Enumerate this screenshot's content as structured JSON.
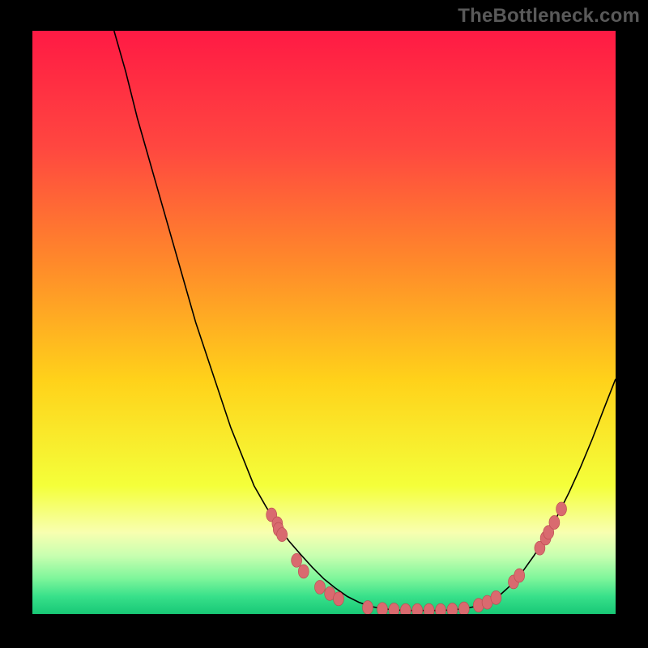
{
  "watermark": "TheBottleneck.com",
  "colors": {
    "bg": "#000000",
    "watermark": "#595959",
    "curve_stroke": "#000000",
    "marker_fill": "#d96a6f",
    "marker_stroke": "#b94a4f",
    "gradient_stops": [
      {
        "offset": 0.0,
        "color": "#ff1a44"
      },
      {
        "offset": 0.2,
        "color": "#ff4740"
      },
      {
        "offset": 0.4,
        "color": "#ff8a2a"
      },
      {
        "offset": 0.6,
        "color": "#ffd21a"
      },
      {
        "offset": 0.78,
        "color": "#f4ff3a"
      },
      {
        "offset": 0.86,
        "color": "#f8ffb0"
      },
      {
        "offset": 0.9,
        "color": "#c8ffb0"
      },
      {
        "offset": 0.94,
        "color": "#7cf59a"
      },
      {
        "offset": 0.97,
        "color": "#38e08a"
      },
      {
        "offset": 1.0,
        "color": "#18c876"
      }
    ]
  },
  "chart_data": {
    "type": "line",
    "title": "",
    "xlabel": "",
    "ylabel": "",
    "xlim": [
      0,
      100
    ],
    "ylim": [
      0,
      100
    ],
    "x": [
      0,
      2,
      4,
      6,
      8,
      10,
      12,
      14,
      16,
      18,
      20,
      22,
      24,
      26,
      28,
      30,
      32,
      34,
      36,
      38,
      40,
      42,
      44,
      46,
      48,
      50,
      52,
      54,
      56,
      58,
      60,
      62,
      64,
      66,
      68,
      70,
      72,
      74,
      76,
      78,
      80,
      82,
      84,
      86,
      88,
      90,
      92,
      94,
      96,
      98,
      100
    ],
    "series": [
      {
        "name": "bottleneck-curve",
        "values": [
          null,
          null,
          null,
          null,
          null,
          null,
          null,
          100,
          93,
          85,
          78,
          71,
          64,
          57,
          50,
          44,
          38,
          32,
          27,
          22,
          18.5,
          15.2,
          12.5,
          10.2,
          8.0,
          6.0,
          4.4,
          3.0,
          2.0,
          1.3,
          0.9,
          0.7,
          0.6,
          0.6,
          0.6,
          0.6,
          0.7,
          0.9,
          1.3,
          2.0,
          3.1,
          4.9,
          7.2,
          10.0,
          13.2,
          16.8,
          20.8,
          25.2,
          30.0,
          35.2,
          40.3
        ]
      }
    ],
    "markers": {
      "name": "scatter-points",
      "points": [
        {
          "x": 41,
          "y": 17.0
        },
        {
          "x": 42,
          "y": 15.5
        },
        {
          "x": 42.2,
          "y": 14.5
        },
        {
          "x": 42.8,
          "y": 13.6
        },
        {
          "x": 45.3,
          "y": 9.2
        },
        {
          "x": 46.5,
          "y": 7.3
        },
        {
          "x": 49.3,
          "y": 4.6
        },
        {
          "x": 51,
          "y": 3.5
        },
        {
          "x": 52.5,
          "y": 2.6
        },
        {
          "x": 57.5,
          "y": 1.1
        },
        {
          "x": 60,
          "y": 0.8
        },
        {
          "x": 62,
          "y": 0.7
        },
        {
          "x": 64,
          "y": 0.6
        },
        {
          "x": 66,
          "y": 0.6
        },
        {
          "x": 68,
          "y": 0.6
        },
        {
          "x": 70,
          "y": 0.6
        },
        {
          "x": 72,
          "y": 0.7
        },
        {
          "x": 74,
          "y": 0.9
        },
        {
          "x": 76.5,
          "y": 1.5
        },
        {
          "x": 78,
          "y": 2.0
        },
        {
          "x": 79.5,
          "y": 2.8
        },
        {
          "x": 82.5,
          "y": 5.5
        },
        {
          "x": 83.5,
          "y": 6.6
        },
        {
          "x": 87,
          "y": 11.3
        },
        {
          "x": 88,
          "y": 13.0
        },
        {
          "x": 88.5,
          "y": 14.0
        },
        {
          "x": 89.5,
          "y": 15.7
        },
        {
          "x": 90.7,
          "y": 18.0
        }
      ]
    }
  }
}
